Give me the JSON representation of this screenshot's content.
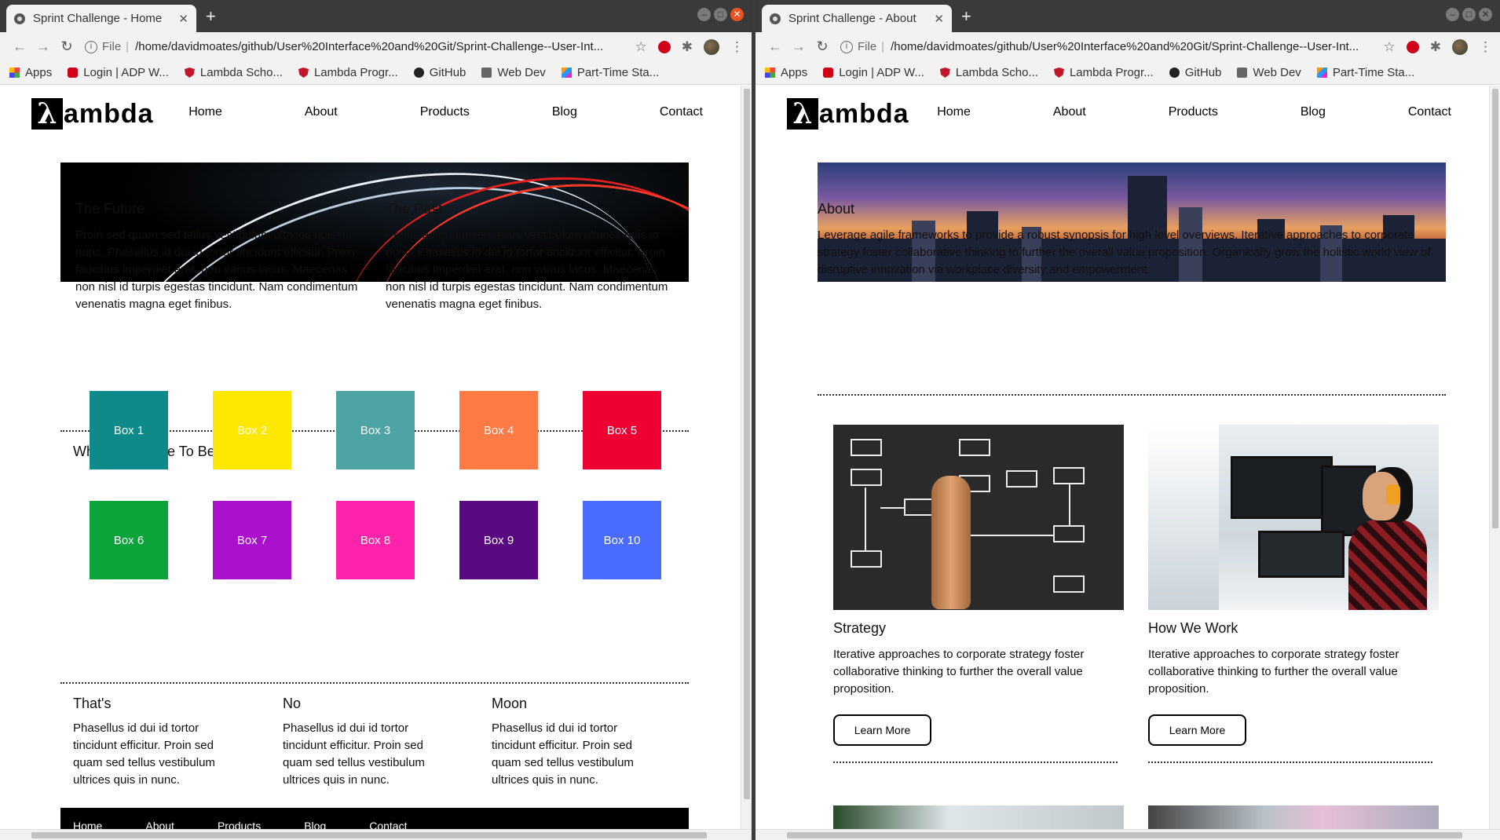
{
  "browser": {
    "apps_label": "Apps",
    "bookmarks": [
      {
        "label": "Login | ADP W...",
        "icon": "adp-icon"
      },
      {
        "label": "Lambda Scho...",
        "icon": "shield-icon"
      },
      {
        "label": "Lambda Progr...",
        "icon": "shield-icon"
      },
      {
        "label": "GitHub",
        "icon": "github-icon"
      },
      {
        "label": "Web Dev",
        "icon": "folder-icon"
      },
      {
        "label": "Part-Time Sta...",
        "icon": "multicolor-icon"
      }
    ],
    "scheme_label": "File",
    "new_tab": "+"
  },
  "left": {
    "tab_title": "Sprint Challenge - Home",
    "url": "/home/davidmoates/github/User%20Interface%20and%20Git/Sprint-Challenge--User-Int...",
    "logo_letter": "λ",
    "logo_word": "ambda",
    "nav": [
      "Home",
      "About",
      "Products",
      "Blog",
      "Contact"
    ],
    "future": {
      "title": "The Future",
      "text": "Proin sed quam sed tellus vestibulum ultrices quis in nunc. Phasellus id dui id tortor tincidunt efficitur. Proin faucibus imperdiet erat, non varius lacus. Maecenas non nisl id turpis egestas tincidunt. Nam condimentum venenatis magna eget finibus."
    },
    "past": {
      "title": "The Past",
      "text": "Proin sed quam sed tellus vestibulum ultrices quis in nunc. Phasellus id dui id tortor tincidunt efficitur. Proin faucibus imperdiet erat, non varius lacus. Maecenas non nisl id turpis egestas tincidunt. Nam condimentum venenatis magna eget finibus."
    },
    "boxes_title": "Why Did It Have To Be Boxes...",
    "boxes": [
      {
        "label": "Box 1",
        "color": "#0f8a8a"
      },
      {
        "label": "Box 2",
        "color": "#ffe800"
      },
      {
        "label": "Box 3",
        "color": "#4ea3a3"
      },
      {
        "label": "Box 4",
        "color": "#ff7a45"
      },
      {
        "label": "Box 5",
        "color": "#ee0033"
      },
      {
        "label": "Box 6",
        "color": "#0aa43a"
      },
      {
        "label": "Box 7",
        "color": "#aa11cc"
      },
      {
        "label": "Box 8",
        "color": "#ff22aa"
      },
      {
        "label": "Box 9",
        "color": "#5a0a80"
      },
      {
        "label": "Box 10",
        "color": "#4a6bff"
      }
    ],
    "bottom": [
      {
        "title": "That's",
        "text": "Phasellus id dui id tortor tincidunt efficitur. Proin sed quam sed tellus vestibulum ultrices quis in nunc."
      },
      {
        "title": "No",
        "text": "Phasellus id dui id tortor tincidunt efficitur. Proin sed quam sed tellus vestibulum ultrices quis in nunc."
      },
      {
        "title": "Moon",
        "text": "Phasellus id dui id tortor tincidunt efficitur. Proin sed quam sed tellus vestibulum ultrices quis in nunc."
      }
    ],
    "footer": [
      "Home",
      "About",
      "Products",
      "Blog",
      "Contact"
    ]
  },
  "right": {
    "tab_title": "Sprint Challenge - About",
    "url": "/home/davidmoates/github/User%20Interface%20and%20Git/Sprint-Challenge--User-Int...",
    "logo_letter": "λ",
    "logo_word": "ambda",
    "nav": [
      "Home",
      "About",
      "Products",
      "Blog",
      "Contact"
    ],
    "about": {
      "title": "About",
      "text": "Leverage agile frameworks to provide a robust synopsis for high level overviews. Iterative approaches to corporate strategy foster collaborative thinking to further the overall value proposition. Organically grow the holistic world view of disruptive innovation via workplace diversity and empowerment."
    },
    "cards": [
      {
        "title": "Strategy",
        "text": "Iterative approaches to corporate strategy foster collaborative thinking to further the overall value proposition.",
        "button": "Learn More"
      },
      {
        "title": "How We Work",
        "text": "Iterative approaches to corporate strategy foster collaborative thinking to further the overall value proposition.",
        "button": "Learn More"
      }
    ]
  }
}
